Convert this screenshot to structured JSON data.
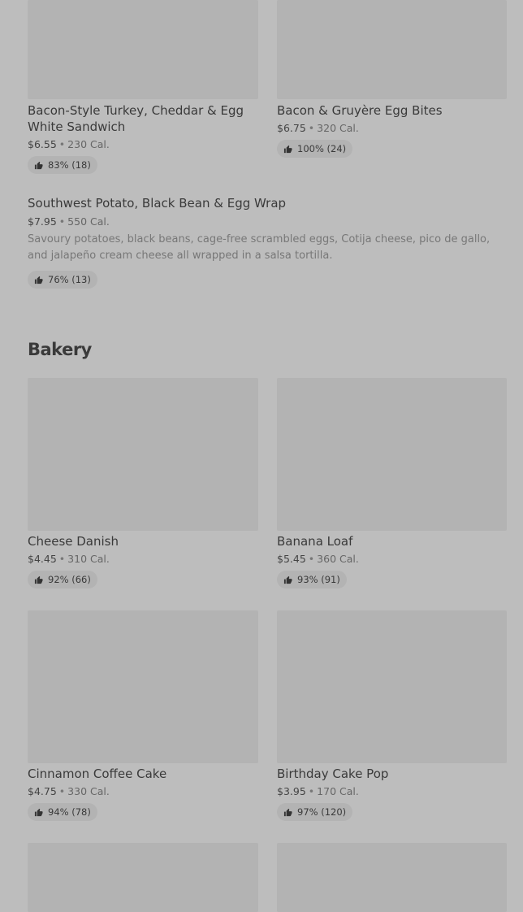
{
  "items_top": [
    {
      "name": "Bacon-Style Turkey, Cheddar & Egg White Sandwich",
      "price": "$6.55",
      "cal": "230 Cal.",
      "rating": "83% (18)"
    },
    {
      "name": "Bacon & Gruyère Egg Bites",
      "price": "$6.75",
      "cal": "320 Cal.",
      "rating": "100% (24)"
    }
  ],
  "wrap": {
    "name": "Southwest Potato, Black Bean & Egg Wrap",
    "price": "$7.95",
    "cal": "550 Cal.",
    "description": "Savoury potatoes, black beans, cage-free scrambled eggs, Cotija cheese, pico de gallo, and jalapeño cream cheese all wrapped in a salsa tortilla.",
    "rating": "76% (13)"
  },
  "bakery": {
    "title": "Bakery",
    "items": [
      {
        "name": "Cheese Danish",
        "price": "$4.45",
        "cal": "310 Cal.",
        "rating": "92% (66)"
      },
      {
        "name": "Banana Loaf",
        "price": "$5.45",
        "cal": "360 Cal.",
        "rating": "93% (91)"
      },
      {
        "name": "Cinnamon Coffee Cake",
        "price": "$4.75",
        "cal": "330 Cal.",
        "rating": "94% (78)"
      },
      {
        "name": "Birthday Cake Pop",
        "price": "$3.95",
        "cal": "170 Cal.",
        "rating": "97% (120)"
      }
    ]
  },
  "separator": "•",
  "icons": {
    "rating": "thumbs-up-icon"
  }
}
